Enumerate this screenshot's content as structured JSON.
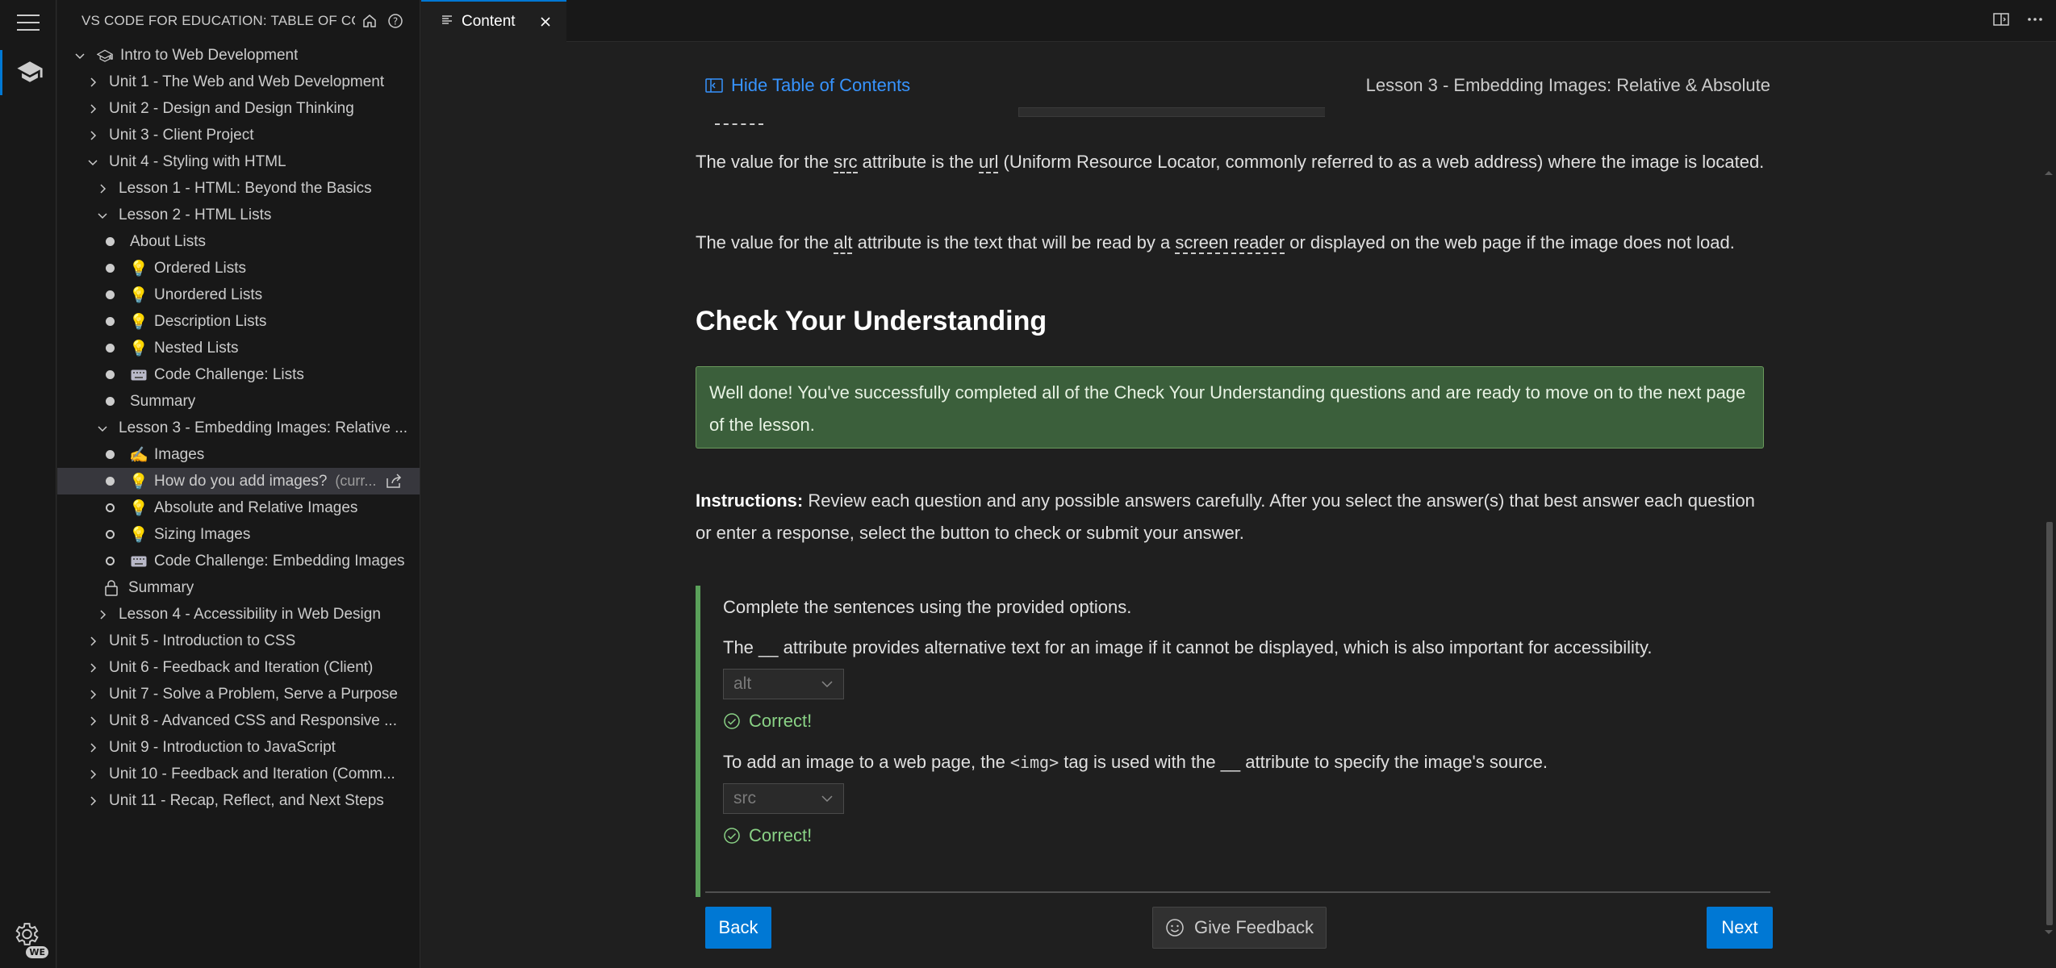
{
  "sidebar": {
    "title": "VS CODE FOR EDUCATION: TABLE OF CON...",
    "root": "Intro to Web Development",
    "units_top": [
      "Unit 1 - The Web and Web Development",
      "Unit 2 - Design and Design Thinking",
      "Unit 3 - Client Project"
    ],
    "unit4": "Unit 4 - Styling with HTML",
    "lesson1": "Lesson 1 - HTML: Beyond the Basics",
    "lesson2": "Lesson 2 - HTML Lists",
    "lesson2_items": [
      "About Lists",
      "Ordered Lists",
      "Unordered Lists",
      "Description Lists",
      "Nested Lists",
      "Code Challenge: Lists",
      "Summary"
    ],
    "lesson3": "Lesson 3 - Embedding Images: Relative ...",
    "lesson3_items": [
      "Images",
      "How do you add images?",
      "Absolute and Relative Images",
      "Sizing Images",
      "Code Challenge: Embedding Images",
      "Summary"
    ],
    "current_suffix": "(curr...",
    "lesson4": "Lesson 4 - Accessibility in Web Design",
    "units_bottom": [
      "Unit 5 - Introduction to CSS",
      "Unit 6 - Feedback and Iteration (Client)",
      "Unit 7 - Solve a Problem, Serve a Purpose",
      "Unit 8 - Advanced CSS and Responsive ...",
      "Unit 9 - Introduction to JavaScript",
      "Unit 10 - Feedback and Iteration (Comm...",
      "Unit 11 - Recap, Reflect, and Next Steps"
    ]
  },
  "activity": {
    "badge": "WE"
  },
  "tab": {
    "label": "Content"
  },
  "content": {
    "hide_toc": "Hide Table of Contents",
    "lesson_title": "Lesson 3 - Embedding Images: Relative & Absolute",
    "p1": {
      "a": "The value for the ",
      "src": "src",
      "b": " attribute is the ",
      "url": "url",
      "c": " (Uniform Resource Locator, commonly referred to as a web address) where the image is located."
    },
    "p2": {
      "a": "The value for the ",
      "alt": "alt",
      "b": " attribute is the text that will be read by a ",
      "sr": "screen reader",
      "c": " or displayed on the web page if the image does not load."
    },
    "section_title": "Check Your Understanding",
    "success_message": "Well done! You've successfully completed all of the Check Your Understanding questions and are ready to move on to the next page of the lesson.",
    "instructions_label": "Instructions:",
    "instructions_text": " Review each question and any possible answers carefully. After you select the answer(s) that best answer each question or enter a response, select the button to check or submit your answer.",
    "quiz": {
      "prompt": "Complete the sentences using the provided options.",
      "q1": "The __ attribute provides alternative text for an image if it cannot be displayed, which is also important for accessibility.",
      "q1_answer": "alt",
      "q2_a": "To add an image to a web page, the ",
      "q2_code": "<img>",
      "q2_b": " tag is used with the __ attribute to specify the image's source.",
      "q2_answer": "src",
      "correct": "Correct!"
    },
    "back": "Back",
    "feedback": "Give Feedback",
    "next": "Next"
  },
  "colors": {
    "accent": "#0078d4",
    "link": "#3794ff",
    "success_bg": "#3b5f3b",
    "correct": "#89d185"
  }
}
